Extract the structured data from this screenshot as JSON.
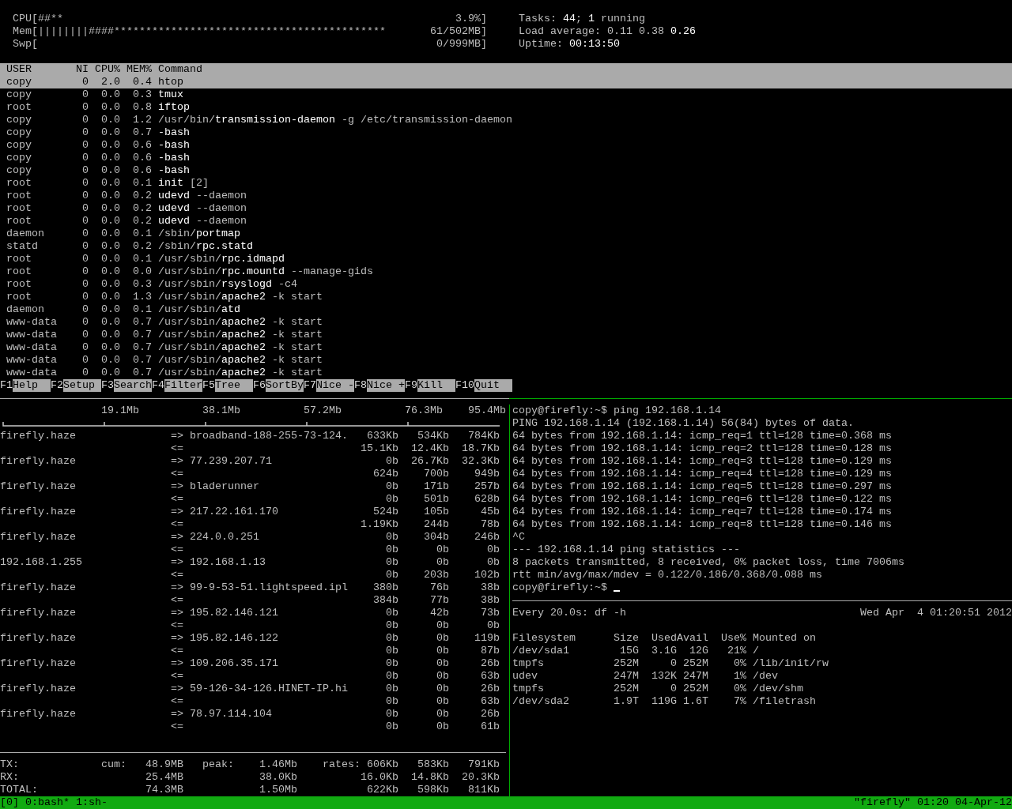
{
  "htop": {
    "meters": [
      {
        "label": "CPU",
        "bar": "[##**",
        "value": "3.9%]"
      },
      {
        "label": "Mem",
        "bar": "[||||||||####*******************************************",
        "value": "61/502MB]"
      },
      {
        "label": "Swp",
        "bar": "[",
        "value": "0/999MB]"
      }
    ],
    "info": [
      "Tasks: **44**; **1** running",
      "Load average: 0.11 0.38 **0.26**",
      "Uptime: **00:13:50**"
    ],
    "columns": [
      "USER",
      "NI",
      "CPU%",
      "MEM%",
      "Command"
    ],
    "processes": [
      {
        "user": "copy",
        "ni": "0",
        "cpu": "2.0",
        "mem": "0.4",
        "command": "**htop**",
        "selected": true
      },
      {
        "user": "copy",
        "ni": "0",
        "cpu": "0.0",
        "mem": "0.3",
        "command": "**tmux**",
        "selected": false
      },
      {
        "user": "root",
        "ni": "0",
        "cpu": "0.0",
        "mem": "0.8",
        "command": "**iftop**",
        "selected": false
      },
      {
        "user": "copy",
        "ni": "0",
        "cpu": "0.0",
        "mem": "1.2",
        "command": "/usr/bin/**transmission-daemon** -g /etc/transmission-daemon",
        "selected": false
      },
      {
        "user": "copy",
        "ni": "0",
        "cpu": "0.0",
        "mem": "0.7",
        "command": "**-bash**",
        "selected": false
      },
      {
        "user": "copy",
        "ni": "0",
        "cpu": "0.0",
        "mem": "0.6",
        "command": "**-bash**",
        "selected": false
      },
      {
        "user": "copy",
        "ni": "0",
        "cpu": "0.0",
        "mem": "0.6",
        "command": "**-bash**",
        "selected": false
      },
      {
        "user": "copy",
        "ni": "0",
        "cpu": "0.0",
        "mem": "0.6",
        "command": "**-bash**",
        "selected": false
      },
      {
        "user": "root",
        "ni": "0",
        "cpu": "0.0",
        "mem": "0.1",
        "command": "**init** [2]",
        "selected": false
      },
      {
        "user": "root",
        "ni": "0",
        "cpu": "0.0",
        "mem": "0.2",
        "command": "**udevd** --daemon",
        "selected": false
      },
      {
        "user": "root",
        "ni": "0",
        "cpu": "0.0",
        "mem": "0.2",
        "command": "**udevd** --daemon",
        "selected": false
      },
      {
        "user": "root",
        "ni": "0",
        "cpu": "0.0",
        "mem": "0.2",
        "command": "**udevd** --daemon",
        "selected": false
      },
      {
        "user": "daemon",
        "ni": "0",
        "cpu": "0.0",
        "mem": "0.1",
        "command": "/sbin/**portmap**",
        "selected": false
      },
      {
        "user": "statd",
        "ni": "0",
        "cpu": "0.0",
        "mem": "0.2",
        "command": "/sbin/**rpc.statd**",
        "selected": false
      },
      {
        "user": "root",
        "ni": "0",
        "cpu": "0.0",
        "mem": "0.1",
        "command": "/usr/sbin/**rpc.idmapd**",
        "selected": false
      },
      {
        "user": "root",
        "ni": "0",
        "cpu": "0.0",
        "mem": "0.0",
        "command": "/usr/sbin/**rpc.mountd** --manage-gids",
        "selected": false
      },
      {
        "user": "root",
        "ni": "0",
        "cpu": "0.0",
        "mem": "0.3",
        "command": "/usr/sbin/**rsyslogd** -c4",
        "selected": false
      },
      {
        "user": "root",
        "ni": "0",
        "cpu": "0.0",
        "mem": "1.3",
        "command": "/usr/sbin/**apache2** -k start",
        "selected": false
      },
      {
        "user": "daemon",
        "ni": "0",
        "cpu": "0.0",
        "mem": "0.1",
        "command": "/usr/sbin/**atd**",
        "selected": false
      },
      {
        "user": "www-data",
        "ni": "0",
        "cpu": "0.0",
        "mem": "0.7",
        "command": "/usr/sbin/**apache2** -k start",
        "selected": false
      },
      {
        "user": "www-data",
        "ni": "0",
        "cpu": "0.0",
        "mem": "0.7",
        "command": "/usr/sbin/**apache2** -k start",
        "selected": false
      },
      {
        "user": "www-data",
        "ni": "0",
        "cpu": "0.0",
        "mem": "0.7",
        "command": "/usr/sbin/**apache2** -k start",
        "selected": false
      },
      {
        "user": "www-data",
        "ni": "0",
        "cpu": "0.0",
        "mem": "0.7",
        "command": "/usr/sbin/**apache2** -k start",
        "selected": false
      },
      {
        "user": "www-data",
        "ni": "0",
        "cpu": "0.0",
        "mem": "0.7",
        "command": "/usr/sbin/**apache2** -k start",
        "selected": false
      }
    ],
    "function_keys": [
      {
        "key": "F1",
        "label": "Help"
      },
      {
        "key": "F2",
        "label": "Setup"
      },
      {
        "key": "F3",
        "label": "Search"
      },
      {
        "key": "F4",
        "label": "Filter"
      },
      {
        "key": "F5",
        "label": "Tree"
      },
      {
        "key": "F6",
        "label": "SortBy"
      },
      {
        "key": "F7",
        "label": "Nice -"
      },
      {
        "key": "F8",
        "label": "Nice +"
      },
      {
        "key": "F9",
        "label": "Kill"
      },
      {
        "key": "F10",
        "label": "Quit"
      }
    ]
  },
  "iftop": {
    "scale": [
      "19.1Mb",
      "38.1Mb",
      "57.2Mb",
      "76.3Mb",
      "95.4Mb"
    ],
    "hosts": [
      {
        "source": "firefly.haze",
        "out_arrow": "=>",
        "destination": "broadband-188-255-73-124.",
        "sent": [
          "633Kb",
          "534Kb",
          "784Kb"
        ],
        "in_arrow": "<=",
        "received": [
          "15.1Kb",
          "12.4Kb",
          "18.7Kb"
        ]
      },
      {
        "source": "firefly.haze",
        "out_arrow": "=>",
        "destination": "77.239.207.71",
        "sent": [
          "0b",
          "26.7Kb",
          "32.3Kb"
        ],
        "in_arrow": "<=",
        "received": [
          "624b",
          "700b",
          "949b"
        ]
      },
      {
        "source": "firefly.haze",
        "out_arrow": "=>",
        "destination": "bladerunner",
        "sent": [
          "0b",
          "171b",
          "257b"
        ],
        "in_arrow": "<=",
        "received": [
          "0b",
          "501b",
          "628b"
        ]
      },
      {
        "source": "firefly.haze",
        "out_arrow": "=>",
        "destination": "217.22.161.170",
        "sent": [
          "524b",
          "105b",
          "45b"
        ],
        "in_arrow": "<=",
        "received": [
          "1.19Kb",
          "244b",
          "78b"
        ]
      },
      {
        "source": "firefly.haze",
        "out_arrow": "=>",
        "destination": "224.0.0.251",
        "sent": [
          "0b",
          "304b",
          "246b"
        ],
        "in_arrow": "<=",
        "received": [
          "0b",
          "0b",
          "0b"
        ]
      },
      {
        "source": "192.168.1.255",
        "out_arrow": "=>",
        "destination": "192.168.1.13",
        "sent": [
          "0b",
          "0b",
          "0b"
        ],
        "in_arrow": "<=",
        "received": [
          "0b",
          "203b",
          "102b"
        ]
      },
      {
        "source": "firefly.haze",
        "out_arrow": "=>",
        "destination": "99-9-53-51.lightspeed.ipl",
        "sent": [
          "380b",
          "76b",
          "38b"
        ],
        "in_arrow": "<=",
        "received": [
          "384b",
          "77b",
          "38b"
        ]
      },
      {
        "source": "firefly.haze",
        "out_arrow": "=>",
        "destination": "195.82.146.121",
        "sent": [
          "0b",
          "42b",
          "73b"
        ],
        "in_arrow": "<=",
        "received": [
          "0b",
          "0b",
          "0b"
        ]
      },
      {
        "source": "firefly.haze",
        "out_arrow": "=>",
        "destination": "195.82.146.122",
        "sent": [
          "0b",
          "0b",
          "119b"
        ],
        "in_arrow": "<=",
        "received": [
          "0b",
          "0b",
          "87b"
        ]
      },
      {
        "source": "firefly.haze",
        "out_arrow": "=>",
        "destination": "109.206.35.171",
        "sent": [
          "0b",
          "0b",
          "26b"
        ],
        "in_arrow": "<=",
        "received": [
          "0b",
          "0b",
          "63b"
        ]
      },
      {
        "source": "firefly.haze",
        "out_arrow": "=>",
        "destination": "59-126-34-126.HINET-IP.hi",
        "sent": [
          "0b",
          "0b",
          "26b"
        ],
        "in_arrow": "<=",
        "received": [
          "0b",
          "0b",
          "63b"
        ]
      },
      {
        "source": "firefly.haze",
        "out_arrow": "=>",
        "destination": "78.97.114.104",
        "sent": [
          "0b",
          "0b",
          "26b"
        ],
        "in_arrow": "<=",
        "received": [
          "0b",
          "0b",
          "61b"
        ]
      }
    ],
    "totals": [
      {
        "label": "TX:",
        "cum_label": "cum:",
        "cum": "48.9MB",
        "peak_label": "peak:",
        "peak": "1.46Mb",
        "rates_label": "rates:",
        "rates": [
          "606Kb",
          "583Kb",
          "791Kb"
        ]
      },
      {
        "label": "RX:",
        "cum": "25.4MB",
        "peak": "38.0Kb",
        "rates": [
          "16.0Kb",
          "14.8Kb",
          "20.3Kb"
        ]
      },
      {
        "label": "TOTAL:",
        "cum": "74.3MB",
        "peak": "1.50Mb",
        "rates": [
          "622Kb",
          "598Kb",
          "811Kb"
        ]
      }
    ]
  },
  "ping": {
    "lines": [
      "copy@firefly:~$ ping 192.168.1.14",
      "PING 192.168.1.14 (192.168.1.14) 56(84) bytes of data.",
      "64 bytes from 192.168.1.14: icmp_req=1 ttl=128 time=0.368 ms",
      "64 bytes from 192.168.1.14: icmp_req=2 ttl=128 time=0.128 ms",
      "64 bytes from 192.168.1.14: icmp_req=3 ttl=128 time=0.129 ms",
      "64 bytes from 192.168.1.14: icmp_req=4 ttl=128 time=0.129 ms",
      "64 bytes from 192.168.1.14: icmp_req=5 ttl=128 time=0.297 ms",
      "64 bytes from 192.168.1.14: icmp_req=6 ttl=128 time=0.122 ms",
      "64 bytes from 192.168.1.14: icmp_req=7 ttl=128 time=0.174 ms",
      "64 bytes from 192.168.1.14: icmp_req=8 ttl=128 time=0.146 ms",
      "^C",
      "--- 192.168.1.14 ping statistics ---",
      "8 packets transmitted, 8 received, 0% packet loss, time 7006ms",
      "rtt min/avg/max/mdev = 0.122/0.186/0.368/0.088 ms"
    ],
    "prompt": "copy@firefly:~$"
  },
  "watch": {
    "command": "Every 20.0s: df -h",
    "time": "Wed Apr  4 01:20:51 2012",
    "columns": [
      "Filesystem",
      "Size",
      "Used",
      "Avail",
      "Use%",
      "Mounted on"
    ],
    "rows": [
      [
        "/dev/sda1",
        "15G",
        "3.1G",
        "12G",
        "21%",
        "/"
      ],
      [
        "tmpfs",
        "252M",
        "0",
        "252M",
        "0%",
        "/lib/init/rw"
      ],
      [
        "udev",
        "247M",
        "132K",
        "247M",
        "1%",
        "/dev"
      ],
      [
        "tmpfs",
        "252M",
        "0",
        "252M",
        "0%",
        "/dev/shm"
      ],
      [
        "/dev/sda2",
        "1.9T",
        "119G",
        "1.6T",
        "7%",
        "/filetrash"
      ]
    ]
  },
  "status_bar": {
    "session": "[0]",
    "windows": [
      "0:bash*",
      "1:sh-"
    ],
    "right": "\"firefly\" 01:20 04-Apr-12"
  }
}
